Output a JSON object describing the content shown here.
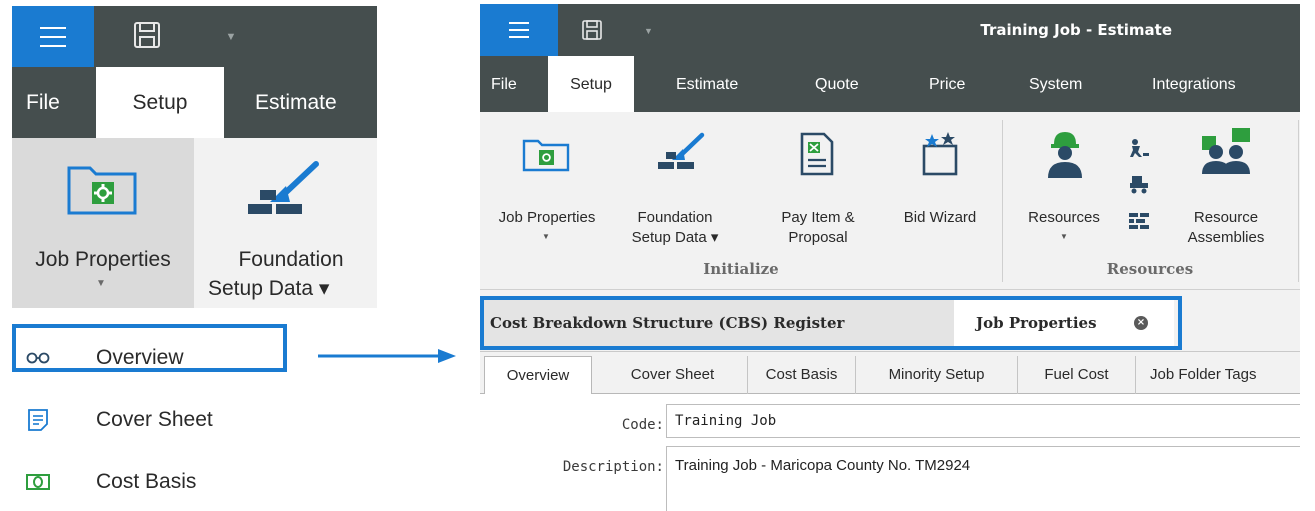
{
  "left": {
    "tabs": {
      "file": "File",
      "setup": "Setup",
      "estimate": "Estimate"
    },
    "ribbon": {
      "job_properties": "Job Properties",
      "foundation_line1": "Foundation",
      "foundation_line2": "Setup Data ▾"
    },
    "menu": {
      "overview": "Overview",
      "cover_sheet": "Cover Sheet",
      "cost_basis": "Cost Basis"
    }
  },
  "right": {
    "title": "Training Job - Estimate",
    "tabs": {
      "file": "File",
      "setup": "Setup",
      "estimate": "Estimate",
      "quote": "Quote",
      "price": "Price",
      "system": "System",
      "integrations": "Integrations"
    },
    "ribbon": {
      "job_properties": "Job Properties",
      "foundation_line1": "Foundation",
      "foundation_line2": "Setup Data ▾",
      "pay_item_line1": "Pay Item &",
      "pay_item_line2": "Proposal",
      "bid_wizard": "Bid Wizard",
      "resources": "Resources",
      "resource_assemblies_line1": "Resource",
      "resource_assemblies_line2": "Assemblies",
      "group_initialize": "Initialize",
      "group_resources": "Resources"
    },
    "doc_tabs": {
      "cbs_register": "Cost Breakdown Structure (CBS) Register",
      "job_properties": "Job Properties"
    },
    "sub_tabs": [
      "Overview",
      "Cover Sheet",
      "Cost Basis",
      "Minority Setup",
      "Fuel Cost",
      "Job Folder Tags"
    ],
    "form": {
      "code_label": "Code:",
      "code_value": "Training Job",
      "description_label": "Description:",
      "description_value": "Training Job - Maricopa County No. TM2924"
    }
  },
  "colors": {
    "accent_blue": "#1a7bd1",
    "dark_bar": "#454e4e",
    "green_icon": "#2e9e3e",
    "ribbon_bg": "#f2f2f2"
  }
}
